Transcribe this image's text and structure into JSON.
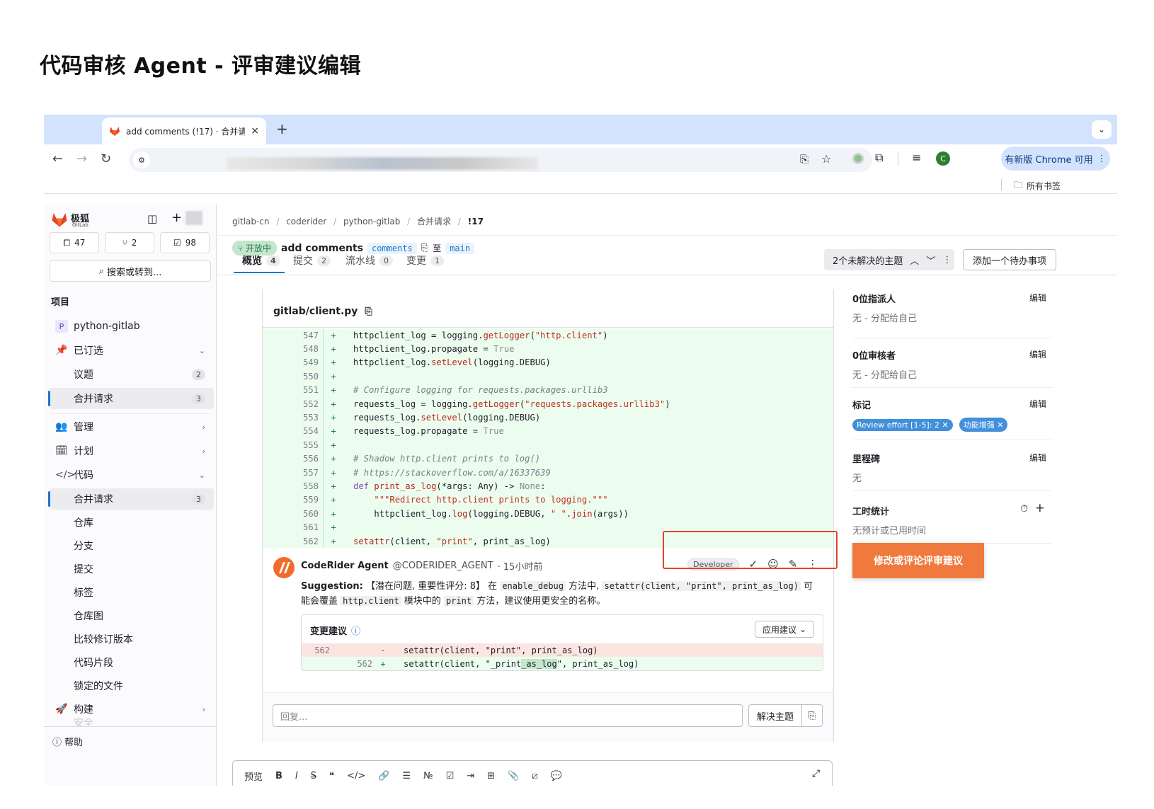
{
  "doc_title": "代码审核 Agent - 评审建议编辑",
  "browser": {
    "tab_title": "add comments (!17) · 合并请求",
    "tab_close": "×",
    "new_tab": "+",
    "tab_menu": "⌄",
    "update_label": "有新版 Chrome 可用",
    "bookmarks_all": "所有书签",
    "profile_initial": "C"
  },
  "sidebar": {
    "brand": "极狐",
    "brand_sub": "GitLab",
    "counters": [
      {
        "icon": "issues-icon",
        "value": "47"
      },
      {
        "icon": "merge-request-icon",
        "value": "2"
      },
      {
        "icon": "todo-icon",
        "value": "98"
      }
    ],
    "search_placeholder": "搜索或转到...",
    "section_label": "项目",
    "project_initial": "P",
    "project_name": "python-gitlab",
    "pinned": "已订选",
    "pinned_items": [
      {
        "label": "议题",
        "count": "2"
      },
      {
        "label": "合并请求",
        "count": "3"
      }
    ],
    "manage": "管理",
    "plan": "计划",
    "code": "代码",
    "code_items": [
      {
        "label": "合并请求",
        "count": "3"
      },
      {
        "label": "仓库"
      },
      {
        "label": "分支"
      },
      {
        "label": "提交"
      },
      {
        "label": "标签"
      },
      {
        "label": "仓库图"
      },
      {
        "label": "比较修订版本"
      },
      {
        "label": "代码片段"
      },
      {
        "label": "锁定的文件"
      }
    ],
    "build": "构建",
    "security": "安全",
    "help": "帮助"
  },
  "mr": {
    "breadcrumb": [
      "gitlab-cn",
      "coderider",
      "python-gitlab",
      "合并请求",
      "!17"
    ],
    "status": "开放中",
    "title": "add comments",
    "source_branch": "comments",
    "to": "至",
    "target_branch": "main",
    "tabs": [
      {
        "label": "概览",
        "count": "4"
      },
      {
        "label": "提交",
        "count": "2"
      },
      {
        "label": "流水线",
        "count": "0"
      },
      {
        "label": "变更",
        "count": "1"
      }
    ],
    "unresolved": "2个未解决的主题",
    "add_todo": "添加一个待办事项"
  },
  "diff": {
    "file": "gitlab/client.py",
    "lines": [
      {
        "n": "547",
        "code": [
          [
            "",
            "httpclient_log = logging."
          ],
          [
            "fn",
            "getLogger"
          ],
          [
            "",
            "("
          ],
          [
            "str",
            "\"http.client\""
          ],
          [
            "",
            ")"
          ]
        ]
      },
      {
        "n": "548",
        "code": [
          [
            "",
            "httpclient_log.propagate = "
          ],
          [
            "lit",
            "True"
          ]
        ]
      },
      {
        "n": "549",
        "code": [
          [
            "",
            "httpclient_log."
          ],
          [
            "fn",
            "setLevel"
          ],
          [
            "",
            "(logging.DEBUG)"
          ]
        ]
      },
      {
        "n": "550",
        "code": []
      },
      {
        "n": "551",
        "code": [
          [
            "cm",
            "# Configure logging for requests.packages.urllib3"
          ]
        ]
      },
      {
        "n": "552",
        "code": [
          [
            "",
            "requests_log = logging."
          ],
          [
            "fn",
            "getLogger"
          ],
          [
            "",
            "("
          ],
          [
            "str",
            "\"requests.packages.urllib3\""
          ],
          [
            "",
            ")"
          ]
        ]
      },
      {
        "n": "553",
        "code": [
          [
            "",
            "requests_log."
          ],
          [
            "fn",
            "setLevel"
          ],
          [
            "",
            "(logging.DEBUG)"
          ]
        ]
      },
      {
        "n": "554",
        "code": [
          [
            "",
            "requests_log.propagate = "
          ],
          [
            "lit",
            "True"
          ]
        ]
      },
      {
        "n": "555",
        "code": []
      },
      {
        "n": "556",
        "code": [
          [
            "cm",
            "# Shadow http.client prints to log()"
          ]
        ]
      },
      {
        "n": "557",
        "code": [
          [
            "cm",
            "# https://stackoverflow.com/a/16337639"
          ]
        ]
      },
      {
        "n": "558",
        "code": [
          [
            "kw",
            "def "
          ],
          [
            "fn",
            "print_as_log"
          ],
          [
            "",
            "(*args: Any) -> "
          ],
          [
            "lit",
            "None"
          ],
          [
            "",
            ":"
          ]
        ]
      },
      {
        "n": "559",
        "code": [
          [
            "",
            "    "
          ],
          [
            "str",
            "\"\"\"Redirect http.client prints to logging.\"\"\""
          ]
        ]
      },
      {
        "n": "560",
        "code": [
          [
            "",
            "    httpclient_log."
          ],
          [
            "fn",
            "log"
          ],
          [
            "",
            "(logging.DEBUG, "
          ],
          [
            "str",
            "\" \""
          ],
          [
            "",
            "."
          ],
          [
            "fn",
            "join"
          ],
          [
            "",
            "(args))"
          ]
        ]
      },
      {
        "n": "561",
        "code": []
      },
      {
        "n": "562",
        "code": [
          [
            "fn",
            "setattr"
          ],
          [
            "",
            "(client, "
          ],
          [
            "str",
            "\"print\""
          ],
          [
            "",
            ", print_as_log)"
          ]
        ]
      }
    ]
  },
  "comment": {
    "author": "CodeRider Agent",
    "handle": "@CODERIDER_AGENT",
    "time": "· 15小时前",
    "role": "Developer",
    "text_prefix": "Suggestion:",
    "text_1": "【潜在问题, 重要性评分: 8】 在",
    "code_1": "enable_debug",
    "text_2": "方法中,",
    "code_2": "setattr(client, \"print\", print_as_log)",
    "text_3": "可",
    "line2_text_1": "能会覆盖",
    "code_3": "http.client",
    "line2_text_2": "模块中的",
    "code_4": "print",
    "line2_text_3": "方法，建议使用更安全的名称。",
    "suggestion_title": "变更建议",
    "apply_label": "应用建议",
    "old_line": {
      "n": "562",
      "sign": "-",
      "code": "setattr(client, \"print\", print_as_log)"
    },
    "new_line": {
      "n": "562",
      "sign": "+",
      "code_a": "setattr(client, \"_print",
      "code_hl": "_as_log",
      "code_b": "\", print_as_log)"
    },
    "reply_placeholder": "回复...",
    "resolve_label": "解决主题"
  },
  "editor": {
    "preview": "预览"
  },
  "right": {
    "assignees_title": "0位指派人",
    "assignees_value": "无 - 分配给自己",
    "reviewers_title": "0位审核者",
    "reviewers_value": "无 - 分配给自己",
    "labels_title": "标记",
    "labels": [
      "Review effort [1-5]: 2",
      "功能增强"
    ],
    "milestone_title": "里程碑",
    "milestone_value": "无",
    "time_title": "工时统计",
    "time_value": "无预计或已用时间",
    "edit": "编辑"
  },
  "callout": "修改或评论评审建议"
}
